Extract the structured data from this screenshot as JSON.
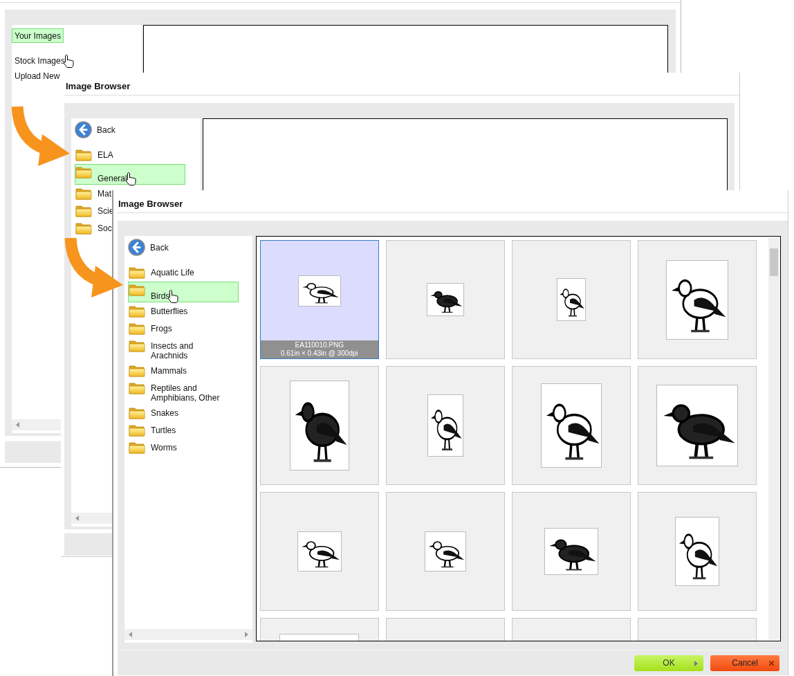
{
  "windows": [
    {
      "sidebar": [
        {
          "label": "Your Images",
          "selected": true,
          "hovered": false
        },
        {
          "label": "Stock Images",
          "selected": false,
          "hovered": true
        },
        {
          "label": "Upload New",
          "selected": false,
          "hovered": false
        }
      ]
    },
    {
      "title": "Image Browser",
      "back": "Back",
      "folders": [
        {
          "label": "ELA",
          "selected": false,
          "hovered": false
        },
        {
          "label": "General",
          "selected": true,
          "hovered": true
        },
        {
          "label": "Mat",
          "selected": false,
          "hovered": false
        },
        {
          "label": "Scie",
          "selected": false,
          "hovered": false
        },
        {
          "label": "Soc",
          "selected": false,
          "hovered": false
        }
      ]
    },
    {
      "title": "Image Browser",
      "back": "Back",
      "folders": [
        {
          "label": "Aquatic Life",
          "selected": false,
          "hovered": false
        },
        {
          "label": "Birds",
          "selected": true,
          "hovered": true
        },
        {
          "label": "Butterflies",
          "selected": false,
          "hovered": false
        },
        {
          "label": "Frogs",
          "selected": false,
          "hovered": false
        },
        {
          "label": "Insects and Arachnids",
          "selected": false,
          "hovered": false
        },
        {
          "label": "Mammals",
          "selected": false,
          "hovered": false
        },
        {
          "label": "Reptiles and Amphibians, Other",
          "selected": false,
          "hovered": false
        },
        {
          "label": "Snakes",
          "selected": false,
          "hovered": false
        },
        {
          "label": "Turtles",
          "selected": false,
          "hovered": false
        },
        {
          "label": "Worms",
          "selected": false,
          "hovered": false
        }
      ],
      "images": [
        {
          "selected": true,
          "filename": "EA110010.PNG",
          "info": "0.61in × 0.43in @ 300dpi"
        },
        {
          "selected": false
        },
        {
          "selected": false
        },
        {
          "selected": false
        },
        {
          "selected": false
        },
        {
          "selected": false
        },
        {
          "selected": false
        },
        {
          "selected": false
        },
        {
          "selected": false
        },
        {
          "selected": false
        },
        {
          "selected": false
        },
        {
          "selected": false
        },
        {
          "selected": false
        },
        {
          "selected": false
        },
        {
          "selected": false
        },
        {
          "selected": false
        }
      ],
      "buttons": [
        {
          "label": "OK",
          "kind": "ok"
        },
        {
          "label": "Cancel",
          "kind": "cancel"
        }
      ]
    }
  ]
}
